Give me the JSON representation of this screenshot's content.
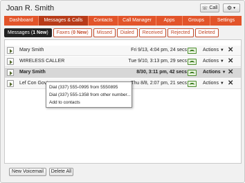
{
  "header": {
    "contact_name": "Joan R. Smith",
    "call_label": "Call",
    "icons": {
      "call": "phone-icon",
      "settings": "gear-icon"
    }
  },
  "nav": {
    "tabs": [
      "Dashboard",
      "Messages & Calls",
      "Contacts",
      "Call Manager",
      "Apps",
      "Groups",
      "Settings"
    ],
    "active": "Messages & Calls",
    "colors": {
      "bar": "#e2542a",
      "active": "#b83b19"
    }
  },
  "subtabs": {
    "messages": {
      "label": "Messages (",
      "count": "1 New",
      "suffix": ")"
    },
    "faxes": {
      "label": "Faxes (",
      "count": "0 New",
      "suffix": ")"
    },
    "missed": "Missed",
    "dialed": "Dialed",
    "received": "Received",
    "rejected": "Rejected",
    "deleted": "Deleted"
  },
  "messages": [
    {
      "caller": "Mary Smith",
      "date": "Fri 9/13, 4:04 pm, 24 secs",
      "actions": "Actions"
    },
    {
      "caller": "WIRELESS CALLER",
      "date": "Tue 9/10, 3:13 pm, 29 secs",
      "actions": "Actions"
    },
    {
      "caller": "Mary Smith",
      "date": "8/30, 3:11 pm, 42 secs",
      "actions": "Actions"
    },
    {
      "caller": "Lef Con Govt",
      "date": "Thu 8/8, 2:07 pm, 21 secs",
      "actions": "Actions"
    }
  ],
  "context_menu": {
    "items": [
      "Dial (337) 555-0995 from 5550895",
      "Dial (337) 555-1358 from other number...",
      "Add to contacts"
    ]
  },
  "footer": {
    "new_voicemail": "New Voicemail",
    "delete_all": "Delete All"
  }
}
